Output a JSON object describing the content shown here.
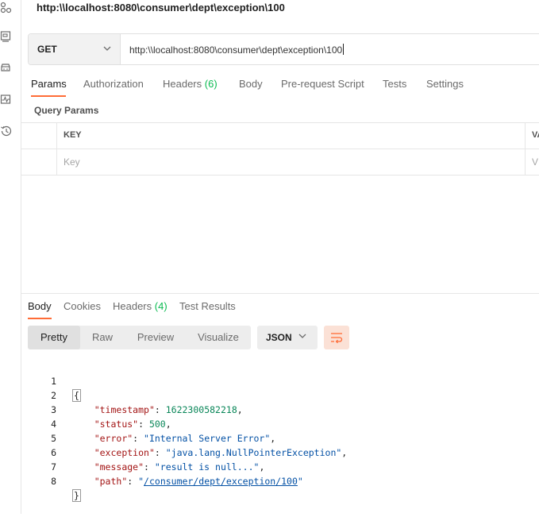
{
  "request": {
    "title": "http:\\\\localhost:8080\\consumer\\dept\\exception\\100",
    "method": "GET",
    "url": "http:\\\\localhost:8080\\consumer\\dept\\exception\\100"
  },
  "request_tabs": [
    {
      "label": "Params",
      "count": ""
    },
    {
      "label": "Authorization",
      "count": ""
    },
    {
      "label": "Headers",
      "count": "(6)"
    },
    {
      "label": "Body",
      "count": ""
    },
    {
      "label": "Pre-request Script",
      "count": ""
    },
    {
      "label": "Tests",
      "count": ""
    },
    {
      "label": "Settings",
      "count": ""
    }
  ],
  "query_params": {
    "title": "Query Params",
    "col_key": "KEY",
    "col_value": "VA",
    "key_placeholder": "Key",
    "value_placeholder": "V"
  },
  "response_tabs": [
    {
      "label": "Body",
      "count": ""
    },
    {
      "label": "Cookies",
      "count": ""
    },
    {
      "label": "Headers",
      "count": "(4)"
    },
    {
      "label": "Test Results",
      "count": ""
    }
  ],
  "view_modes": [
    "Pretty",
    "Raw",
    "Preview",
    "Visualize"
  ],
  "format": "JSON",
  "response_body": {
    "timestamp_key": "\"timestamp\"",
    "timestamp_val": "1622300582218",
    "status_key": "\"status\"",
    "status_val": "500",
    "error_key": "\"error\"",
    "error_val": "\"Internal Server Error\"",
    "exception_key": "\"exception\"",
    "exception_val": "\"java.lang.NullPointerException\"",
    "message_key": "\"message\"",
    "message_val": "\"result is null...\"",
    "path_key": "\"path\"",
    "path_val": "/consumer/dept/exception/100",
    "line_numbers": [
      "1",
      "2",
      "3",
      "4",
      "5",
      "6",
      "7",
      "8"
    ]
  },
  "colors": {
    "accent": "#ff6c37",
    "count_green": "#0cbb52"
  }
}
